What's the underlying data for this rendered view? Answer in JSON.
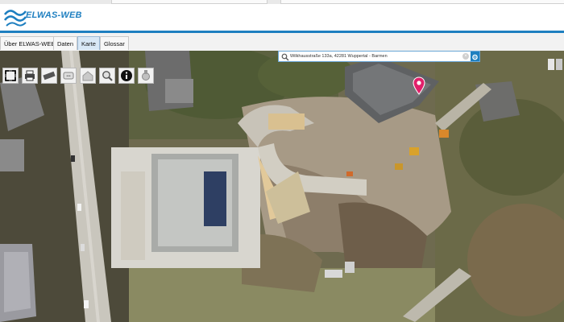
{
  "app": {
    "logo_text": "ELWAS-WEB",
    "colors": {
      "accent": "#1e7fc0",
      "pin": "#e0206a"
    }
  },
  "tabs": [
    {
      "label": "Über ELWAS-WEB",
      "active": false
    },
    {
      "label": "Daten",
      "active": false
    },
    {
      "label": "Karte",
      "active": true
    },
    {
      "label": "Glossar",
      "active": false
    }
  ],
  "search": {
    "value": "Wilkhausstraße 133a, 42281 Wuppertal - Barmen",
    "icon": "search-icon",
    "clear_icon": "clear-icon",
    "settings_icon": "gear-icon"
  },
  "toolbar": {
    "tools": [
      {
        "name": "fullscreen-icon"
      },
      {
        "name": "print-icon"
      },
      {
        "name": "measure-icon"
      },
      {
        "name": "zoom-extent-icon"
      },
      {
        "name": "home-icon"
      },
      {
        "name": "zoom-search-icon"
      },
      {
        "name": "info-icon"
      },
      {
        "name": "tools-icon"
      }
    ]
  },
  "map": {
    "type": "aerial-photo",
    "marker_icon": "location-pin-icon"
  }
}
